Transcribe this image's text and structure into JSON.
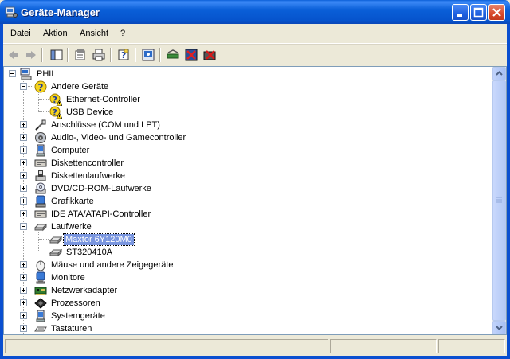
{
  "window": {
    "title": "Geräte-Manager",
    "title_bar_color": "#0a5fd8",
    "buttons": [
      "minimize-icon",
      "maximize-icon",
      "close-icon"
    ]
  },
  "menu": {
    "items": [
      "Datei",
      "Aktion",
      "Ansicht",
      "?"
    ]
  },
  "toolbar": {
    "icons": [
      "back-arrow-icon",
      "forward-arrow-icon",
      "console-tree-icon",
      "properties-icon",
      "print-icon",
      "help-icon",
      "scan-hardware-icon",
      "update-driver-icon",
      "disable-device-icon",
      "uninstall-device-icon"
    ]
  },
  "tree": {
    "root": "PHIL",
    "nodes": [
      {
        "label": "Andere Geräte",
        "expanded": true,
        "icon": "unknown-device-icon"
      },
      {
        "label": "Ethernet-Controller",
        "icon": "warning-device-icon"
      },
      {
        "label": "USB Device",
        "icon": "warning-device-icon"
      },
      {
        "label": "Anschlüsse (COM und LPT)",
        "expanded": false,
        "icon": "port-icon"
      },
      {
        "label": "Audio-, Video- und Gamecontroller",
        "expanded": false,
        "icon": "speaker-icon"
      },
      {
        "label": "Computer",
        "expanded": false,
        "icon": "computer-icon"
      },
      {
        "label": "Diskettencontroller",
        "expanded": false,
        "icon": "controller-icon"
      },
      {
        "label": "Diskettenlaufwerke",
        "expanded": false,
        "icon": "floppy-icon"
      },
      {
        "label": "DVD/CD-ROM-Laufwerke",
        "expanded": false,
        "icon": "cdrom-icon"
      },
      {
        "label": "Grafikkarte",
        "expanded": false,
        "icon": "display-adapter-icon"
      },
      {
        "label": "IDE ATA/ATAPI-Controller",
        "expanded": false,
        "icon": "controller-icon"
      },
      {
        "label": "Laufwerke",
        "expanded": true,
        "icon": "drive-icon"
      },
      {
        "label": "Maxtor 6Y120M0",
        "icon": "drive-icon",
        "selected": true
      },
      {
        "label": "ST320410A",
        "icon": "drive-icon"
      },
      {
        "label": "Mäuse und andere Zeigegeräte",
        "expanded": false,
        "icon": "mouse-icon"
      },
      {
        "label": "Monitore",
        "expanded": false,
        "icon": "monitor-icon"
      },
      {
        "label": "Netzwerkadapter",
        "expanded": false,
        "icon": "network-adapter-icon"
      },
      {
        "label": "Prozessoren",
        "expanded": false,
        "icon": "processor-icon"
      },
      {
        "label": "Systemgeräte",
        "expanded": false,
        "icon": "system-device-icon"
      },
      {
        "label": "Tastaturen",
        "expanded": false,
        "icon": "keyboard-icon"
      }
    ]
  },
  "colors": {
    "selection": "#7a96df",
    "frame": "#0a4fd0",
    "warning": "#f7d51d"
  }
}
